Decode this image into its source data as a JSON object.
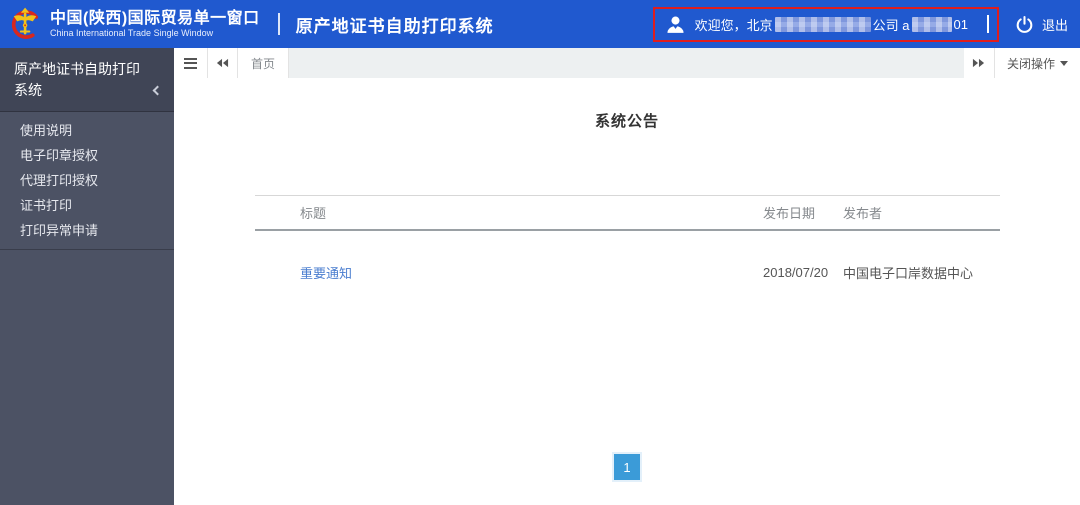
{
  "header": {
    "logo_title_zh": "中国(陕西)国际贸易单一窗口",
    "logo_title_en": "China International Trade Single Window",
    "system_title": "原产地证书自助打印系统",
    "welcome_prefix": "欢迎您，北京",
    "welcome_middle": "公司 a",
    "welcome_suffix": "01",
    "logout_label": "退出"
  },
  "sidebar": {
    "title": "原产地证书自助打印系统",
    "items": [
      {
        "label": "使用说明"
      },
      {
        "label": "电子印章授权"
      },
      {
        "label": "代理打印授权"
      },
      {
        "label": "证书打印"
      },
      {
        "label": "打印异常申请"
      }
    ]
  },
  "tabbar": {
    "home_tab": "首页",
    "close_menu_label": "关闭操作"
  },
  "announcements": {
    "title": "系统公告",
    "columns": {
      "title": "标题",
      "date": "发布日期",
      "publisher": "发布者"
    },
    "rows": [
      {
        "title": "重要通知",
        "date": "2018/07/20",
        "publisher": "中国电子口岸数据中心"
      }
    ],
    "pagination": {
      "current_page": "1"
    }
  },
  "colors": {
    "header_blue": "#2059cf",
    "sidebar_bg": "#4c5264",
    "sidebar_header_bg": "#404556",
    "annotation_red": "#e01d1d",
    "link_blue": "#4a7dcf",
    "pagination_blue": "#3b9bd8",
    "tab_fill": "#edf0f1"
  }
}
